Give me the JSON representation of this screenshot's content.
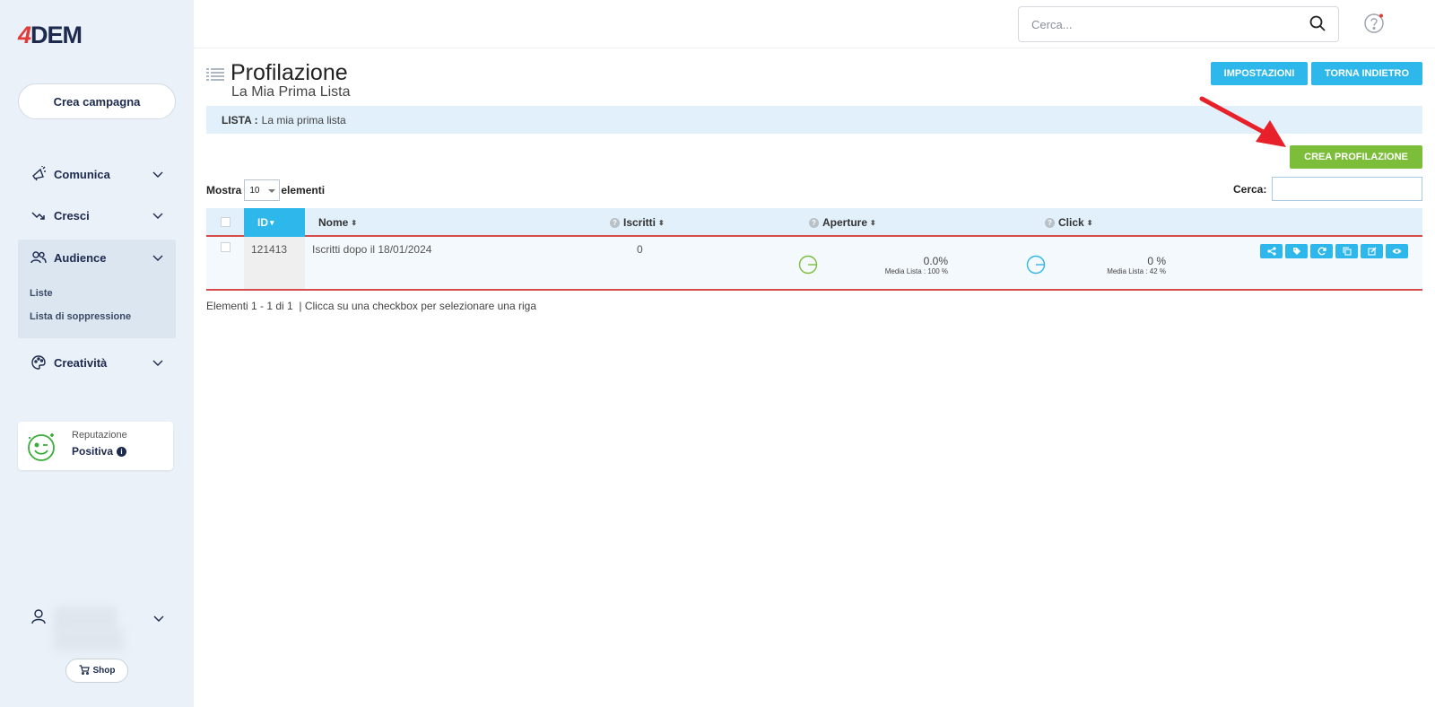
{
  "sidebar": {
    "logo_mark": "4",
    "logo_text": "DEM",
    "create_campaign": "Crea campagna",
    "nav": [
      {
        "label": "Comunica"
      },
      {
        "label": "Cresci"
      },
      {
        "label": "Audience"
      },
      {
        "label": "Creatività"
      }
    ],
    "audience_sub": [
      "Liste",
      "Lista di soppressione"
    ],
    "reputation": {
      "label": "Reputazione",
      "value": "Positiva"
    },
    "shop": "Shop"
  },
  "topbar": {
    "search_placeholder": "Cerca..."
  },
  "page": {
    "title": "Profilazione",
    "subtitle": "La Mia Prima Lista",
    "btn_settings": "IMPOSTAZIONI",
    "btn_back": "TORNA INDIETRO",
    "lista_label": "LISTA :",
    "lista_value": "La mia prima lista",
    "btn_create": "CREA PROFILAZIONE",
    "show_label": "Mostra",
    "show_value": "10",
    "show_suffix": "elementi",
    "search_label": "Cerca:"
  },
  "table": {
    "headers": {
      "id": "ID",
      "name": "Nome",
      "subscribers": "Iscritti",
      "opens": "Aperture",
      "clicks": "Click"
    },
    "rows": [
      {
        "id": "121413",
        "name": "Iscritti dopo il 18/01/2024",
        "subscribers": "0",
        "opens_pct": "0.0%",
        "opens_media": "Media Lista : 100 %",
        "clicks_pct": "0 %",
        "clicks_media": "Media Lista : 42 %"
      }
    ]
  },
  "footer": {
    "info": "Elementi 1 - 1 di 1",
    "hint": "| Clicca su una checkbox per selezionare una riga"
  },
  "colors": {
    "accent_blue": "#2db7ea",
    "accent_green": "#7cbd3a",
    "highlight_red": "#d84b4b",
    "annotation_arrow": "#e8202a"
  }
}
